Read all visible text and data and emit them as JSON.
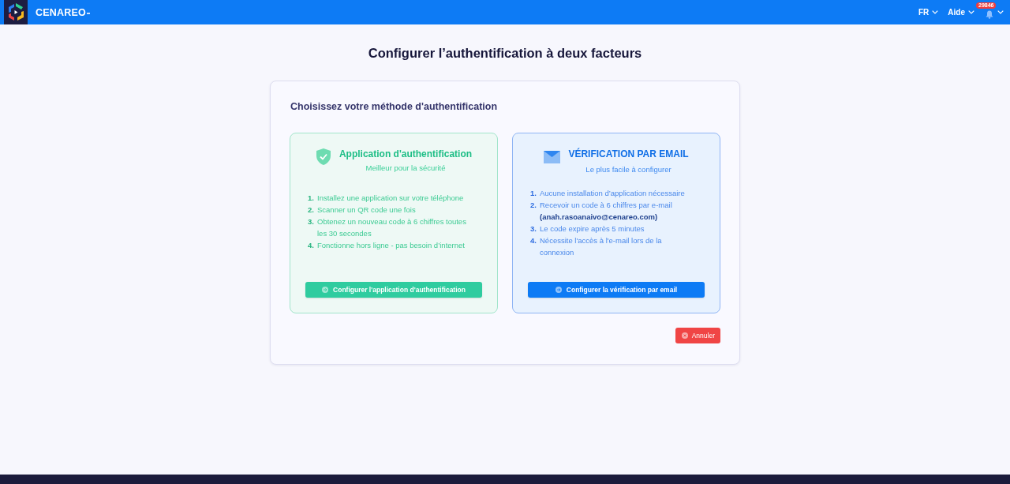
{
  "header": {
    "brand": "CENAREO",
    "menus": [
      {
        "label": "FR"
      },
      {
        "label": "Aide"
      }
    ],
    "notifications": {
      "badge": "29846"
    }
  },
  "page": {
    "title": "Configurer l’authentification à deux facteurs"
  },
  "card": {
    "heading": "Choisissez votre méthode d'authentification",
    "options": [
      {
        "kind": "app",
        "title": "Application d'authentification",
        "subtitle": "Meilleur pour la sécurité",
        "steps": [
          {
            "number": "1.",
            "text": "Installez une application sur votre téléphone"
          },
          {
            "number": "2.",
            "text": "Scanner un QR code une fois"
          },
          {
            "number": "3.",
            "text": "Obtenez un nouveau code à 6 chiffres toutes les 30 secondes"
          },
          {
            "number": "4.",
            "text": "Fonctionne hors ligne - pas besoin d’internet"
          }
        ],
        "button": "Configurer l'application d'authentification"
      },
      {
        "kind": "email",
        "title": "VÉRIFICATION PAR EMAIL",
        "subtitle": "Le plus facile à configurer",
        "steps": [
          {
            "number": "1.",
            "text": "Aucune installation d’application nécessaire"
          },
          {
            "number": "2.",
            "text": "Recevoir un code à 6 chiffres par e-mail **(anah.rasoanaivo@cenareo.com)**"
          },
          {
            "number": "3.",
            "text": "Le code expire après 5 minutes"
          },
          {
            "number": "4.",
            "text": "Nécessite l'accès à l'e-mail lors de la connexion"
          }
        ],
        "button": "Configurer la vérification par email"
      }
    ],
    "cancel_button": "Annuler"
  }
}
